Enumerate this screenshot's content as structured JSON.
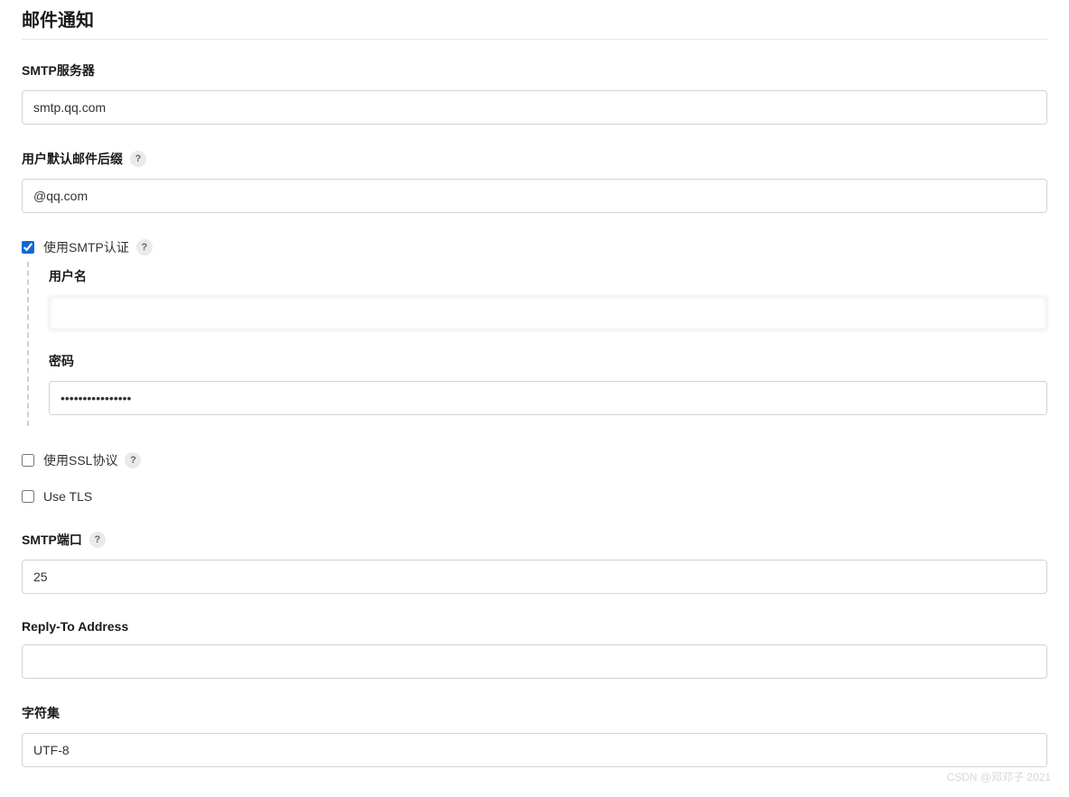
{
  "section": {
    "title": "邮件通知"
  },
  "fields": {
    "smtp_server": {
      "label": "SMTP服务器",
      "value": "smtp.qq.com"
    },
    "default_suffix": {
      "label": "用户默认邮件后缀",
      "value": "@qq.com",
      "help": "?"
    },
    "use_smtp_auth": {
      "label": "使用SMTP认证",
      "help": "?",
      "checked": true
    },
    "username": {
      "label": "用户名",
      "value": ""
    },
    "password": {
      "label": "密码",
      "value": "••••••••••••••••"
    },
    "use_ssl": {
      "label": "使用SSL协议",
      "help": "?",
      "checked": false
    },
    "use_tls": {
      "label": "Use TLS",
      "checked": false
    },
    "smtp_port": {
      "label": "SMTP端口",
      "value": "25",
      "help": "?"
    },
    "reply_to": {
      "label": "Reply-To Address",
      "value": ""
    },
    "charset": {
      "label": "字符集",
      "value": "UTF-8"
    }
  },
  "watermark": "CSDN @邓邓子 2021"
}
